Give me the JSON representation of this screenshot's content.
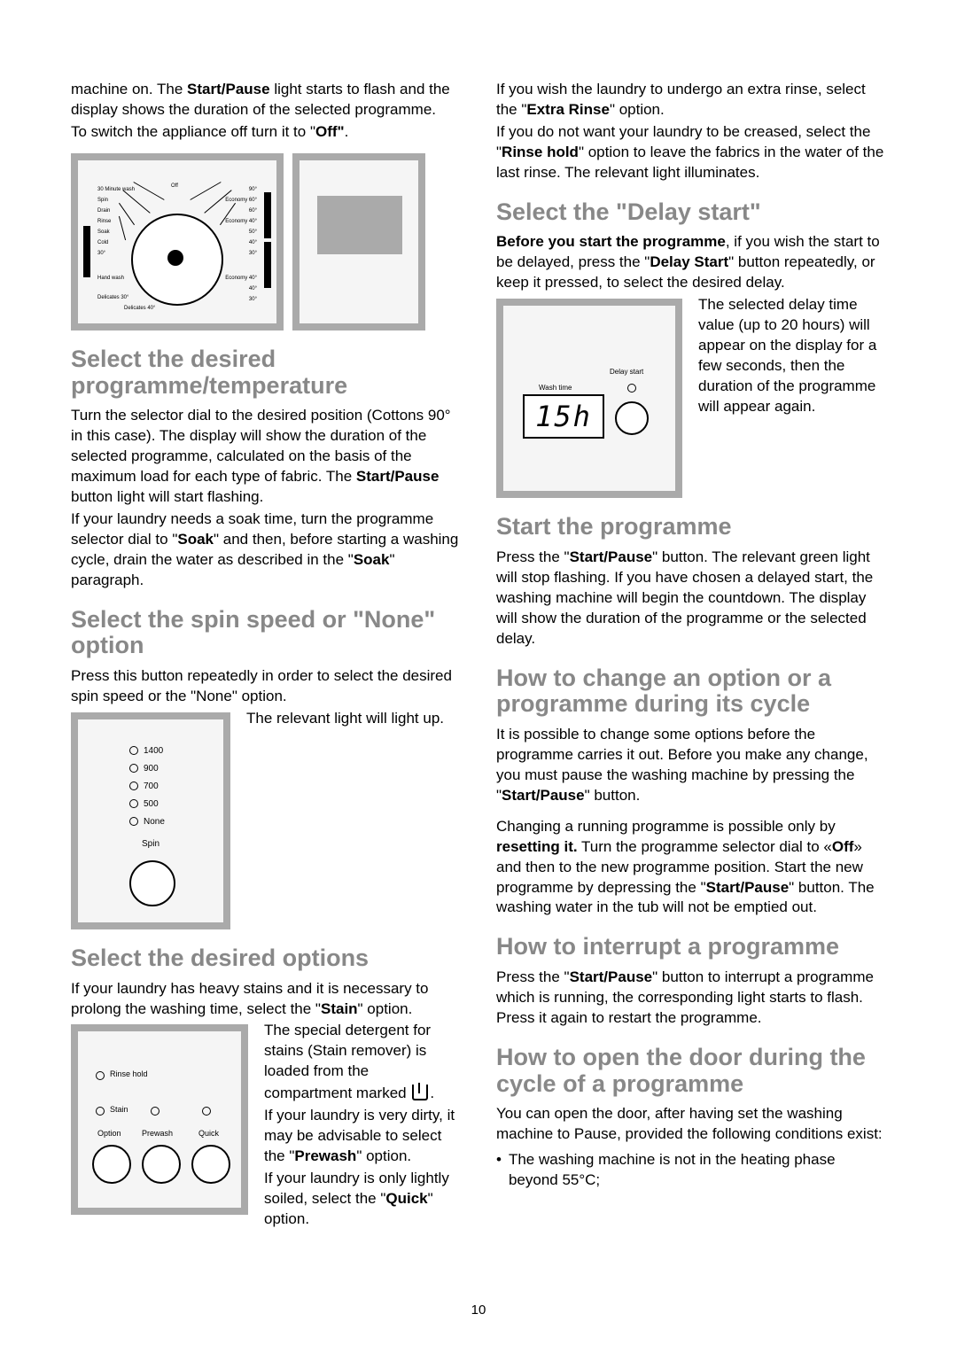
{
  "page_number": "10",
  "left_col": {
    "intro_p1_a": "machine on. The ",
    "intro_p1_bold1": "Start/Pause",
    "intro_p1_b": " light starts to flash and the display shows the duration of the selected programme.",
    "intro_p2_a": "To switch the appliance off turn it to \"",
    "intro_p2_bold": "Off\"",
    "intro_p2_b": ".",
    "dial_labels": {
      "off": "Off",
      "thirty": "30 Minute wash",
      "spin": "Spin",
      "drain": "Drain",
      "rinse": "Rinse",
      "soak": "Soak",
      "cold": "Cold",
      "thirty_deg": "30°",
      "handwash": "Hand wash",
      "del30": "Delicates 30°",
      "del40": "Delicates 40°",
      "r90": "90°",
      "econ60": "Economy 60°",
      "r60": "60°",
      "econ40": "Economy 40°",
      "r50": "50°",
      "r40": "40°",
      "r30": "30°",
      "econ402": "Economy 40°",
      "r402": "40°",
      "r302": "30°"
    },
    "h_select_prog": "Select the desired programme/temperature",
    "select_prog_p1_a": "Turn the selector dial to the desired position (Cottons 90° in this case). The display will show the duration of the selected programme, calculated on the basis of the maximum load for each type of fabric. The ",
    "select_prog_p1_bold": "Start/Pause",
    "select_prog_p1_b": " button light will start flashing.",
    "select_prog_p2_a": "If your laundry needs a soak time, turn the programme selector dial to \"",
    "select_prog_p2_bold1": "Soak",
    "select_prog_p2_b": "\" and then, before starting a washing cycle, drain the water as described in the \"",
    "select_prog_p2_bold2": "Soak",
    "select_prog_p2_c": "\" paragraph.",
    "h_spin": "Select the spin speed or \"None\" option",
    "spin_p1": "Press this button repeatedly in order to select the desired spin speed or the \"None\" option.",
    "spin_p2": "The relevant light will light up.",
    "spin_items": [
      "1400",
      "900",
      "700",
      "500",
      "None"
    ],
    "spin_label": "Spin",
    "h_options": "Select the desired options",
    "opt_p1_a": "If your laundry has heavy stains and it is necessary to prolong the washing time, select the \"",
    "opt_p1_bold": "Stain",
    "opt_p1_b": "\" option.",
    "opt_p2_a": "The special detergent for stains (Stain remover) is loaded from the compartment marked ",
    "opt_p2_b": ".",
    "opt_p3_a": "If your laundry is very dirty, it may be advisable to select the \"",
    "opt_p3_bold": "Prewash",
    "opt_p3_b": "\" option.",
    "opt_p4_a": "If your laundry is only lightly soiled, select the \"",
    "opt_p4_bold": "Quick",
    "opt_p4_b": "\" option.",
    "opt_labels": {
      "rinse_hold": "Rinse hold",
      "stain": "Stain",
      "option": "Option",
      "prewash": "Prewash",
      "quick": "Quick"
    }
  },
  "right_col": {
    "intro_p1_a": "If you wish the laundry to undergo an extra rinse, select the \"",
    "intro_p1_bold": "Extra Rinse",
    "intro_p1_b": "\" option.",
    "intro_p2_a": "If you do not want your laundry to be creased, select the \"",
    "intro_p2_bold": "Rinse hold",
    "intro_p2_b": "\" option to leave the fabrics in the water of the last rinse. The relevant light illuminates.",
    "h_delay": "Select the \"Delay start\"",
    "delay_p1_bold": "Before you start the programme",
    "delay_p1_a": ", if you wish the start to be delayed, press the \"",
    "delay_p1_bold2": "Delay Start",
    "delay_p1_b": "\" button repeatedly, or keep it pressed, to select the desired delay.",
    "delay_p2": "The selected delay time value (up to 20 hours) will appear on the display for a few seconds, then the duration of the programme will appear again.",
    "delay_panel": {
      "wash_time": "Wash time",
      "delay_start": "Delay start",
      "display": "15h"
    },
    "h_start": "Start the programme",
    "start_p1_a": "Press the \"",
    "start_p1_bold": "Start/Pause",
    "start_p1_b": "\" button. The relevant green light will stop flashing. If you have chosen a delayed start, the washing machine will begin the countdown. The display will show the duration of the programme or the selected delay.",
    "h_change": "How to change an option or a programme during its cycle",
    "change_p1_a": "It is possible to change some options before the programme carries it out. Before you make any change, you must pause the washing machine by pressing the \"",
    "change_p1_bold": "Start/Pause",
    "change_p1_b": "\" button.",
    "change_p2_a": "Changing a running programme is possible only by ",
    "change_p2_bold1": "resetting it.",
    "change_p2_b": " Turn the programme selector dial to «",
    "change_p2_bold2": "Off",
    "change_p2_c": "» and then to the new programme position. Start the new programme by depressing the \"",
    "change_p2_bold3": "Start/Pause",
    "change_p2_d": "\" button. The washing water in the tub will not be emptied out.",
    "h_interrupt": "How to interrupt a programme",
    "interrupt_p1_a": "Press the \"",
    "interrupt_p1_bold": "Start/Pause",
    "interrupt_p1_b": "\" button to interrupt a programme which is running, the corresponding light starts to flash. Press it again to restart the programme.",
    "h_door": "How to open the door during the cycle of a programme",
    "door_p1": "You can open the door, after having set the washing machine to Pause, provided the following conditions exist:",
    "door_bullet": "•",
    "door_b1": "The washing machine is not in the heating phase beyond 55°C;"
  }
}
